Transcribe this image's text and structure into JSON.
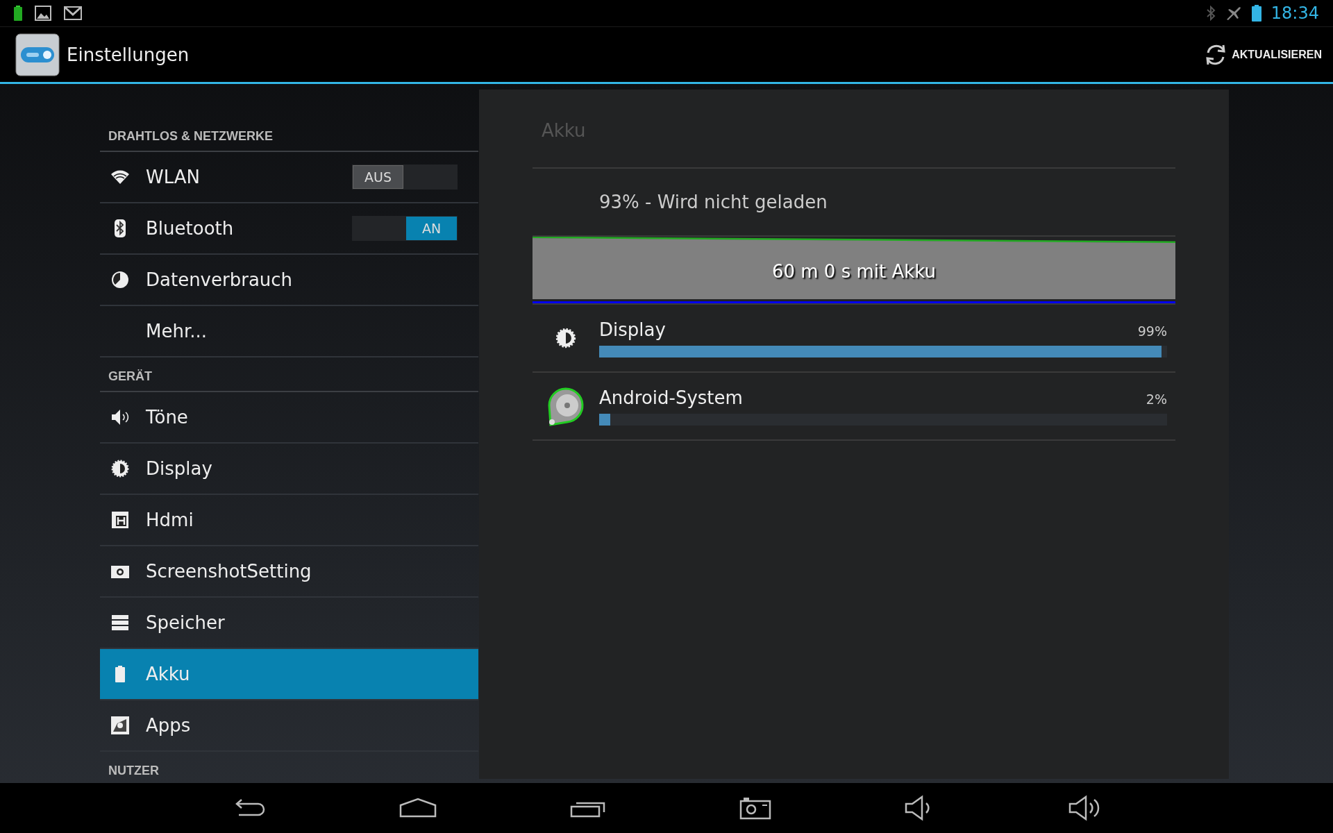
{
  "status_bar": {
    "time": "18:34"
  },
  "action_bar": {
    "title": "Einstellungen",
    "action": "AKTUALISIEREN"
  },
  "sidebar": {
    "sections": [
      {
        "title": "DRAHTLOS & NETZWERKE",
        "items": [
          {
            "label": "WLAN",
            "selected": false,
            "toggle": {
              "label": "AUS",
              "on": false
            }
          },
          {
            "label": "Bluetooth",
            "selected": false,
            "toggle": {
              "label": "AN",
              "on": true
            }
          },
          {
            "label": "Datenverbrauch",
            "selected": false
          },
          {
            "label": "Mehr...",
            "selected": false
          }
        ]
      },
      {
        "title": "GERÄT",
        "items": [
          {
            "label": "Töne",
            "selected": false
          },
          {
            "label": "Display",
            "selected": false
          },
          {
            "label": "Hdmi",
            "selected": false
          },
          {
            "label": "ScreenshotSetting",
            "selected": false
          },
          {
            "label": "Speicher",
            "selected": false
          },
          {
            "label": "Akku",
            "selected": true
          },
          {
            "label": "Apps",
            "selected": false
          }
        ]
      },
      {
        "title": "NUTZER"
      }
    ]
  },
  "panel": {
    "title": "Akku",
    "status": "93% - Wird nicht geladen",
    "graph_label": "60 m 0 s mit Akku",
    "usage": [
      {
        "name": "Display",
        "percent": "99%",
        "level": 0.99
      },
      {
        "name": "Android-System",
        "percent": "2%",
        "level": 0.02
      }
    ]
  }
}
